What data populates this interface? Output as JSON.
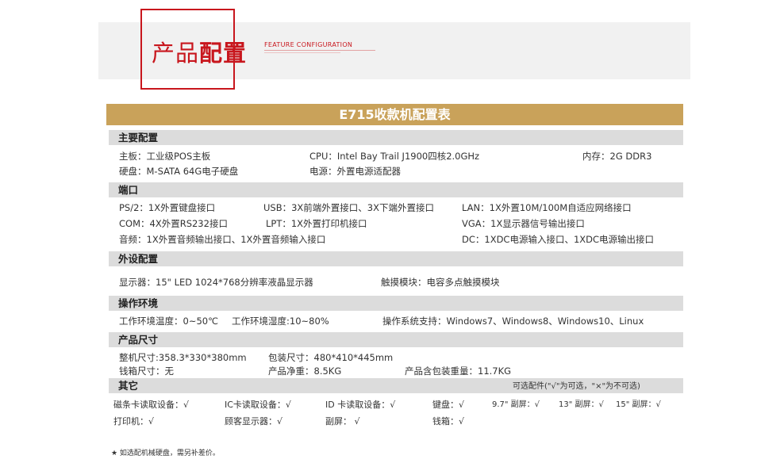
{
  "header": {
    "title_light": "产品",
    "title_bold": "配置",
    "subtitle_en": "FEATURE CONFIGURATION"
  },
  "table_title": "E715收款机配置表",
  "sections": {
    "main": {
      "heading": "主要配置",
      "board": "主板：工业级POS主板",
      "cpu": "CPU：Intel Bay Trail J1900四核2.0GHz",
      "memory": "内存：2G DDR3",
      "disk": "硬盘：M-SATA 64G电子硬盘",
      "power": "电源：外置电源适配器"
    },
    "ports": {
      "heading": "端口",
      "ps2": "PS/2：1X外置键盘接口",
      "usb": "USB：3X前端外置接口、3X下端外置接口",
      "lan": "LAN：1X外置10M/100M自适应网络接口",
      "com": "COM：4X外置RS232接口",
      "lpt": "LPT：1X外置打印机接口",
      "vga": "VGA：1X显示器信号输出接口",
      "audio": "音频：1X外置音频输出接口、1X外置音频输入接口",
      "dc": "DC：1XDC电源输入接口、1XDC电源输出接口"
    },
    "peripherals": {
      "heading": "外设配置",
      "display": "显示器：15\"  LED 1024*768分辨率液晶显示器",
      "touch": "触摸模块：电容多点触摸模块"
    },
    "environment": {
      "heading": "操作环境",
      "work_temp": "工作环境温度：0~50℃",
      "work_humidity": "工作环境湿度:10~80%",
      "os": "操作系统支持：Windows7、Windows8、Windows10、Linux"
    },
    "size": {
      "heading": "产品尺寸",
      "machine": "整机尺寸:358.3*330*380mm",
      "package": "包装尺寸：480*410*445mm",
      "drawer": "钱箱尺寸：无",
      "net_weight": "产品净重：8.5KG",
      "gross_weight": "产品含包装重量：11.7KG"
    },
    "other": {
      "heading": "其它",
      "optional_label": "可选配件(\"√\"为可选，\"×\"为不可选)",
      "items": [
        "磁条卡读取设备：√",
        "IC卡读取设备：√",
        "ID 卡读取设备：√",
        "键盘：√",
        "9.7\" 副屏：√",
        "13\" 副屏：√",
        "15\" 副屏：√",
        "打印机：√",
        "顾客显示器：√",
        "副屏：  √",
        "钱箱：√"
      ]
    }
  },
  "footnote": "★ 如选配机械硬盘，需另补差价。",
  "colors": {
    "accent_red": "#c8161d",
    "title_gold": "#c9a25a",
    "section_gray": "#dcdcdc"
  }
}
